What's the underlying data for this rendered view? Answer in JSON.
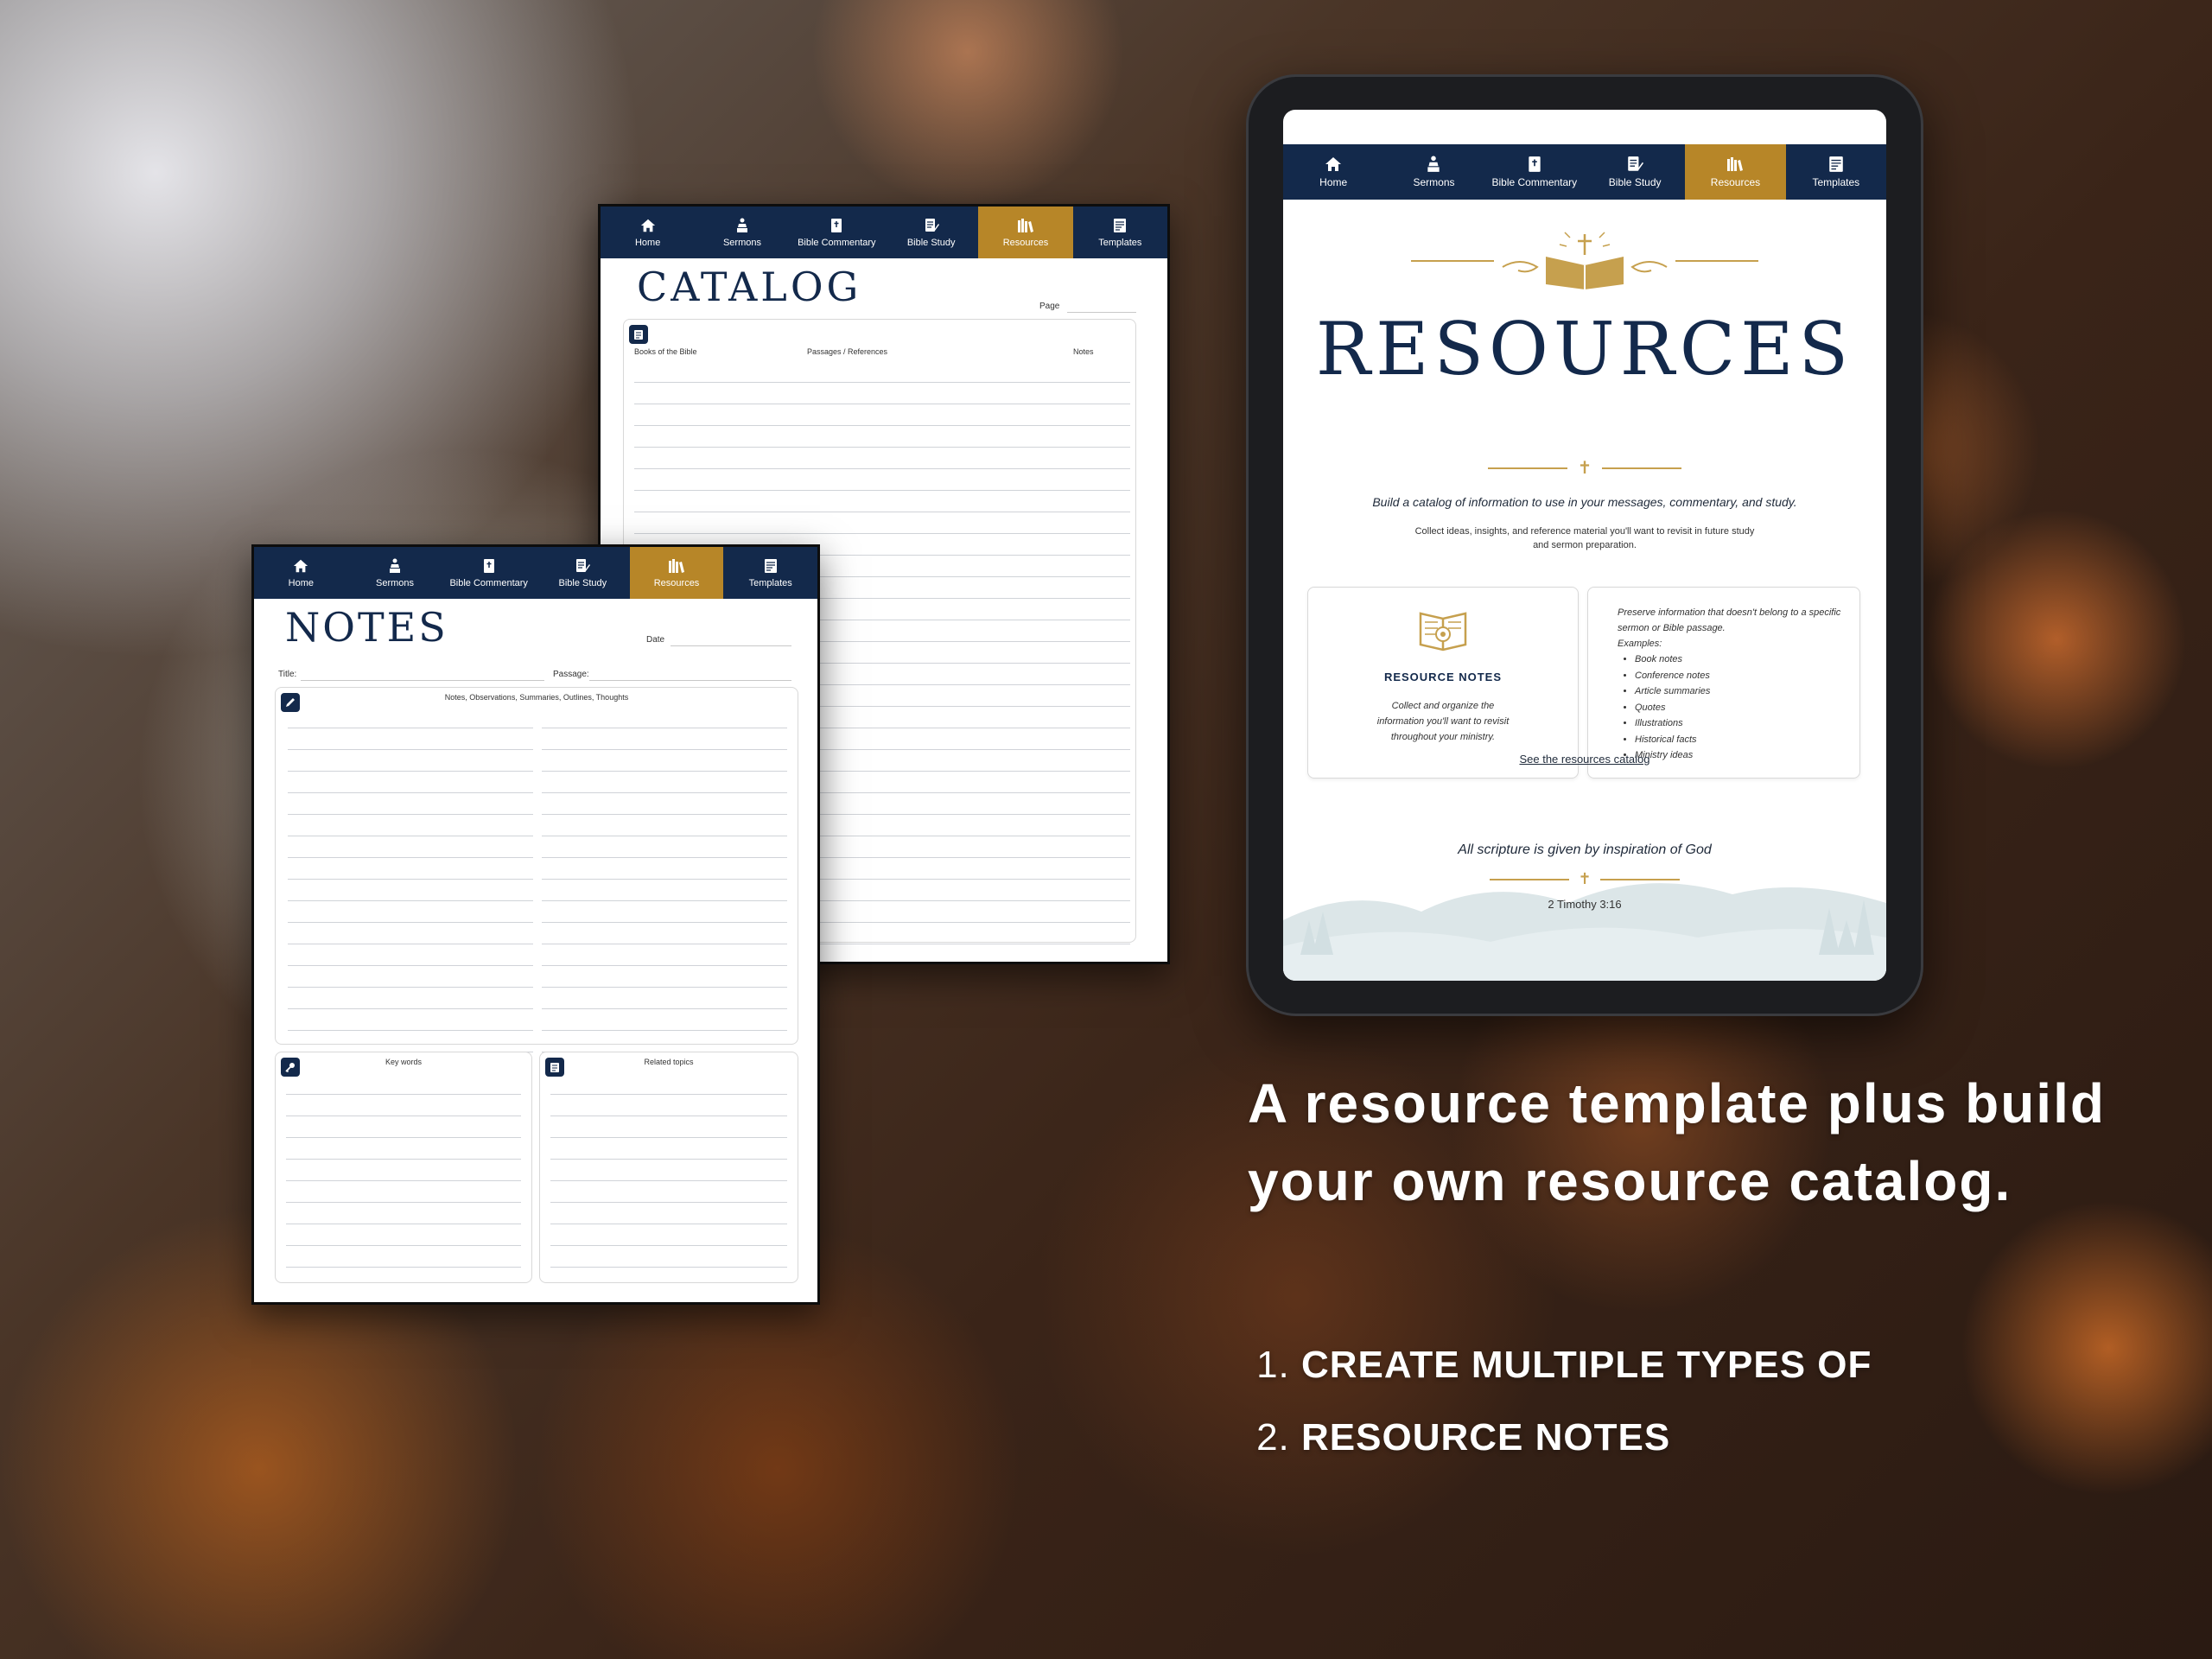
{
  "nav": {
    "items": [
      {
        "label": "Home",
        "icon": "home-icon"
      },
      {
        "label": "Sermons",
        "icon": "sermons-icon"
      },
      {
        "label": "Bible Commentary",
        "icon": "bible-icon"
      },
      {
        "label": "Bible Study",
        "icon": "study-icon"
      },
      {
        "label": "Resources",
        "icon": "books-icon"
      },
      {
        "label": "Templates",
        "icon": "templates-icon"
      }
    ],
    "active": "Resources",
    "active_color": "#b78628",
    "bar_color": "#13294b"
  },
  "catalog": {
    "title": "CATALOG",
    "page_label": "Page",
    "columns": [
      "Books of the Bible",
      "Passages / References",
      "Notes"
    ]
  },
  "notes": {
    "title": "NOTES",
    "date_label": "Date",
    "title_label": "Title:",
    "passage_label": "Passage:",
    "main_box": "Notes, Observations, Summaries, Outlines, Thoughts",
    "keywords_box": "Key words",
    "related_box": "Related topics"
  },
  "resources": {
    "title": "RESOURCES",
    "tagline": "Build a catalog of information to use in your messages, commentary, and study.",
    "description": "Collect ideas, insights, and reference material you'll want to revisit in future study and sermon preparation.",
    "card1": {
      "title": "RESOURCE NOTES",
      "description": "Collect and organize the information you'll want to revisit throughout your ministry."
    },
    "card2": {
      "intro": "Preserve information that doesn't belong to a specific sermon or Bible passage.",
      "examples_label": "Examples:",
      "examples": [
        "Book notes",
        "Conference notes",
        "Article summaries",
        "Quotes",
        "Illustrations",
        "Historical facts",
        "Ministry ideas"
      ]
    },
    "link": "See the resources catalog",
    "quote": "All scripture is given by inspiration of God",
    "reference": "2 Timothy 3:16",
    "accent_color": "#c6a04e"
  },
  "headline": "A resource template plus build your own resource catalog.",
  "steps": [
    "CREATE MULTIPLE TYPES OF",
    "RESOURCE NOTES"
  ]
}
